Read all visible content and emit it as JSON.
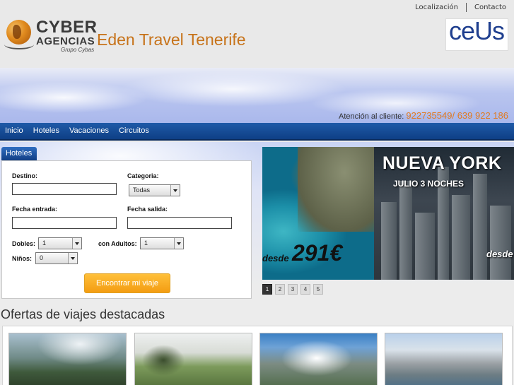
{
  "header": {
    "top_links": [
      "Localización",
      "Contacto"
    ],
    "logo": {
      "line1": "CYBER",
      "line2": "AGENCIAS",
      "line3": "Grupo Cybas"
    },
    "site_title": "Eden Travel Tenerife",
    "partner_logo": {
      "text": "ceUs"
    }
  },
  "contact": {
    "label": "Atención al cliente:",
    "phones": "922735549/ 639 922 186"
  },
  "nav": {
    "items": [
      "Inicio",
      "Hoteles",
      "Vacaciones",
      "Circuitos"
    ]
  },
  "search": {
    "tab_label": "Hoteles",
    "destino_label": "Destino:",
    "destino_value": "",
    "categoria_label": "Categoria:",
    "categoria_value": "Todas",
    "fecha_entrada_label": "Fecha entrada:",
    "fecha_entrada_value": "",
    "fecha_salida_label": "Fecha salida:",
    "fecha_salida_value": "",
    "dobles_label": "Dobles:",
    "dobles_value": "1",
    "adultos_label": "con Adultos:",
    "adultos_value": "1",
    "ninos_label": "Niños:",
    "ninos_value": "0",
    "submit_label": "Encontrar mi viaje"
  },
  "banner": {
    "title": "NUEVA YORK",
    "subtitle": "JULIO 3 NOCHES",
    "desde_left": "desde",
    "price": "291€",
    "desde_right": "desde",
    "pages": [
      "1",
      "2",
      "3",
      "4",
      "5"
    ],
    "active_page": "1"
  },
  "offers": {
    "title": "Ofertas de viajes destacadas",
    "count": 4
  },
  "colors": {
    "accent_orange": "#e07b24",
    "nav_blue": "#0e3f85",
    "button_orange": "#f39c12"
  }
}
